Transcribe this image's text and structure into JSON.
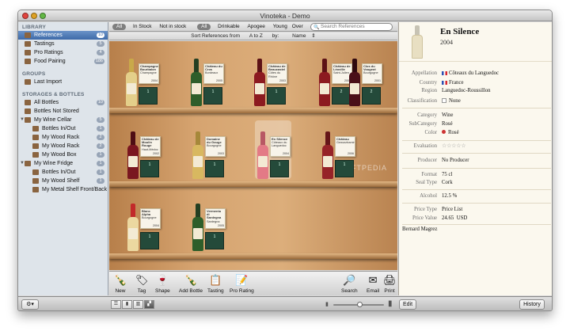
{
  "window": {
    "title": "Vinoteka - Demo"
  },
  "sidebar": {
    "library_header": "LIBRARY",
    "library": [
      {
        "label": "References",
        "count": "10",
        "selected": true
      },
      {
        "label": "Tastings",
        "count": "5"
      },
      {
        "label": "Pro Ratings",
        "count": "4"
      },
      {
        "label": "Food Pairing",
        "count": "186"
      }
    ],
    "groups_header": "GROUPS",
    "groups": [
      {
        "label": "Last Import"
      }
    ],
    "storages_header": "STORAGES & BOTTLES",
    "storages": [
      {
        "label": "All Bottles",
        "count": "10",
        "indent": 0
      },
      {
        "label": "Bottles Not Stored",
        "count": "",
        "indent": 0
      },
      {
        "label": "My Wine Cellar",
        "count": "5",
        "indent": 0,
        "expanded": true
      },
      {
        "label": "Bottles In/Out",
        "count": "1",
        "indent": 1
      },
      {
        "label": "My Wood Rack",
        "count": "2",
        "indent": 1
      },
      {
        "label": "My Wood Rack",
        "count": "2",
        "indent": 1
      },
      {
        "label": "My Wood Box",
        "count": "1",
        "indent": 1
      },
      {
        "label": "My Wine Fridge",
        "count": "1",
        "indent": 0,
        "expanded": true
      },
      {
        "label": "Bottles In/Out",
        "count": "1",
        "indent": 1
      },
      {
        "label": "My Wood Shelf",
        "count": "1",
        "indent": 1
      },
      {
        "label": "My Metal Shelf Front/Back",
        "count": "",
        "indent": 1
      }
    ]
  },
  "filters": {
    "stock_all": "All",
    "in_stock": "In Stock",
    "not_in_stock": "Not in stock",
    "status_all": "All",
    "drinkable": "Drinkable",
    "apogee": "Apogee",
    "young": "Young",
    "over": "Over"
  },
  "search": {
    "placeholder": "Search References",
    "icon": "search-icon"
  },
  "sort": {
    "prefix": "Sort References from",
    "order": "A to Z",
    "by_label": "by:",
    "by_value": "Name"
  },
  "shelves": [
    [
      {
        "name": "Champagne Bourbalon",
        "extra": "Champagne",
        "year": "2004",
        "color": "#e4cf8a",
        "neck": "#c9a94a",
        "board": "1"
      },
      {
        "name": "Château du Cros",
        "extra": "Bordeaux",
        "year": "2005",
        "color": "#2e5e2a",
        "neck": "#243f22",
        "board": "1"
      },
      {
        "name": "Château de Beaucastel",
        "extra": "Côtes du Rhône",
        "year": "2003",
        "color": "#8c1a20",
        "neck": "#5c1216",
        "board": "1"
      },
      {
        "name": "Château de Léoville",
        "extra": "Saint-Julien",
        "year": "2000",
        "color": "#8c1a20",
        "neck": "#5c1216",
        "board": "2"
      },
      {
        "name": "Clos du Vougeot",
        "extra": "Bourgogne",
        "year": "2001",
        "color": "#4a0f18",
        "neck": "#30090f",
        "board": "2"
      }
    ],
    [
      {
        "name": "Château de Moulin Rouge",
        "extra": "Haut-Médoc",
        "year": "2002",
        "color": "#7a1620",
        "neck": "#4e0e14",
        "board": "1"
      },
      {
        "name": "Domaine du Gouge",
        "extra": "Bourgogne",
        "year": "2003",
        "color": "#d8b860",
        "neck": "#a6883a",
        "board": "1"
      },
      {
        "name": "En Silence",
        "extra": "Côteaux du Languedoc",
        "year": "2004",
        "color": "#e37a86",
        "neck": "#b85864",
        "board": "1",
        "selected": true
      },
      {
        "name": "Château",
        "extra": "Gewurztraminer",
        "year": "2006",
        "color": "#962328",
        "neck": "#651619",
        "board": "1"
      }
    ],
    [
      {
        "name": "Blanc Alpha",
        "extra": "Bourgogne",
        "year": "2004",
        "color": "#ecd8a0",
        "neck": "#c22a2a",
        "board": "1"
      },
      {
        "name": "Vermentu di Sardegna",
        "extra": "Sardegna",
        "year": "2005",
        "color": "#2e5e2a",
        "neck": "#243f22",
        "board": "1"
      }
    ]
  ],
  "watermark": "SOFTPEDIA",
  "toolbar": {
    "new": "New",
    "tag": "Tag",
    "shape": "Shape",
    "add_bottle": "Add Bottle",
    "tasting": "Tasting",
    "pro_rating": "Pro Rating",
    "search": "Search",
    "email": "Email",
    "print": "Print"
  },
  "detail": {
    "title": "En Silence",
    "year": "2004",
    "appellation_label": "Appellation",
    "appellation": "Côteaux du Languedoc",
    "country_label": "Country",
    "country": "France",
    "region_label": "Region",
    "region": "Languedoc-Roussillon",
    "classification_label": "Classification",
    "classification": "None",
    "category_label": "Category",
    "category": "Wine",
    "subcategory_label": "SubCategory",
    "subcategory": "Rosé",
    "color_label": "Color",
    "color": "Rosé",
    "evaluation_label": "Evaluation",
    "evaluation": "☆☆☆☆☆",
    "producer_label": "Producer",
    "producer": "No Producer",
    "format_label": "Format",
    "format": "75 cl",
    "seal_label": "Seal Type",
    "seal": "Cork",
    "alcohol_label": "Alcohol",
    "alcohol": "12.5 %",
    "price_type_label": "Price Type",
    "price_type": "Price List",
    "price_value_label": "Price Value",
    "price_value": "24.65",
    "currency": "USD",
    "note": "Bernard Magrez"
  },
  "status": {
    "gear": "⚙▾",
    "edit": "Edit",
    "history": "History"
  },
  "colors": {
    "selection": "#3e6aa8",
    "shelf_wood": "#d6a470",
    "detail_bg": "#fbf8ee"
  }
}
